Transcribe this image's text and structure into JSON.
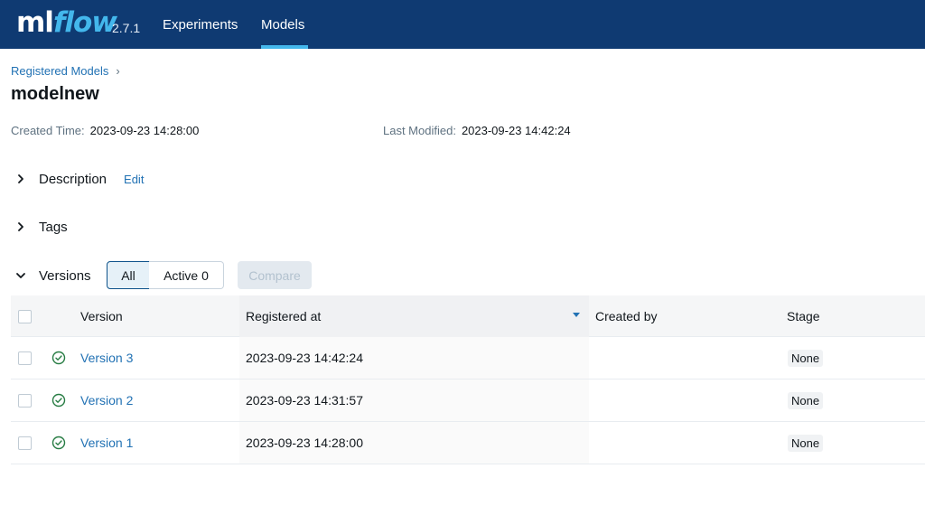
{
  "app": {
    "logo_ml": "ml",
    "logo_flow": "flow",
    "version": "2.7.1",
    "nav": [
      {
        "label": "Experiments"
      },
      {
        "label": "Models"
      }
    ],
    "colors": {
      "header_bg": "#0f3a72",
      "accent": "#43b7ec",
      "link": "#2272b4",
      "success": "#277c43"
    }
  },
  "breadcrumb": {
    "label": "Registered Models",
    "separator": "›"
  },
  "page_title": "modelnew",
  "meta": {
    "created_label": "Created Time:",
    "created_value": "2023-09-23 14:28:00",
    "modified_label": "Last Modified:",
    "modified_value": "2023-09-23 14:42:24"
  },
  "sections": {
    "description": {
      "label": "Description",
      "edit_label": "Edit",
      "expanded": false
    },
    "tags": {
      "label": "Tags",
      "expanded": false
    },
    "versions": {
      "label": "Versions",
      "expanded": true
    }
  },
  "filters": {
    "all_label": "All",
    "active_label": "Active 0",
    "selected": "All",
    "compare_label": "Compare"
  },
  "table": {
    "columns": [
      "Version",
      "Registered at",
      "Created by",
      "Stage"
    ],
    "sorted_column": "Registered at",
    "rows": [
      {
        "version": "Version 3",
        "registered_at": "2023-09-23 14:42:24",
        "created_by": "",
        "stage": "None",
        "status_icon": "check-circle-icon"
      },
      {
        "version": "Version 2",
        "registered_at": "2023-09-23 14:31:57",
        "created_by": "",
        "stage": "None",
        "status_icon": "check-circle-icon"
      },
      {
        "version": "Version 1",
        "registered_at": "2023-09-23 14:28:00",
        "created_by": "",
        "stage": "None",
        "status_icon": "check-circle-icon"
      }
    ]
  }
}
